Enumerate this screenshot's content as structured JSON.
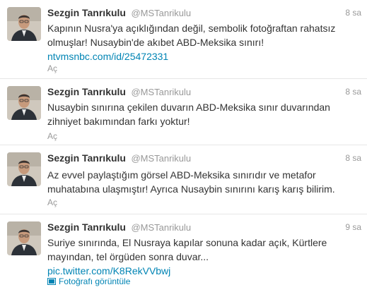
{
  "tweets": [
    {
      "name": "Sezgin Tanrıkulu",
      "handle": "@MSTanrikulu",
      "time": "8 sa",
      "lines": [
        "Kapının Nusra'ya açıklığından değil, sembolik fotoğraftan rahatsız",
        "olmuşlar! Nusaybin'de akıbet ABD-Meksika sınırı!"
      ],
      "link": "ntvmsnbc.com/id/25472331",
      "action": "Aç"
    },
    {
      "name": "Sezgin Tanrıkulu",
      "handle": "@MSTanrikulu",
      "time": "8 sa",
      "lines": [
        "Nusaybin sınırına çekilen duvarın ABD-Meksika sınır duvarından",
        "zihniyet bakımından farkı yoktur!"
      ],
      "action": "Aç"
    },
    {
      "name": "Sezgin Tanrıkulu",
      "handle": "@MSTanrikulu",
      "time": "8 sa",
      "lines": [
        "Az evvel paylaştığım görsel ABD-Meksika sınırıdır ve metafor",
        "muhatabına ulaşmıştır! Ayrıca Nusaybin sınırını karış karış bilirim."
      ],
      "action": "Aç"
    },
    {
      "name": "Sezgin Tanrıkulu",
      "handle": "@MSTanrikulu",
      "time": "9 sa",
      "lines": [
        "Suriye sınırında, El Nusraya kapılar sonuna kadar açık, Kürtlere",
        "mayından, tel örgüden sonra duvar..."
      ],
      "link": "pic.twitter.com/K8RekVVbwj",
      "action": "Fotoğrafı görüntüle",
      "action_icon": "photo-icon"
    }
  ],
  "colors": {
    "link": "#0084b4",
    "meta": "#999999",
    "text": "#333333",
    "divider": "#e6e6e6"
  },
  "avatar_icon": "person-portrait-icon"
}
